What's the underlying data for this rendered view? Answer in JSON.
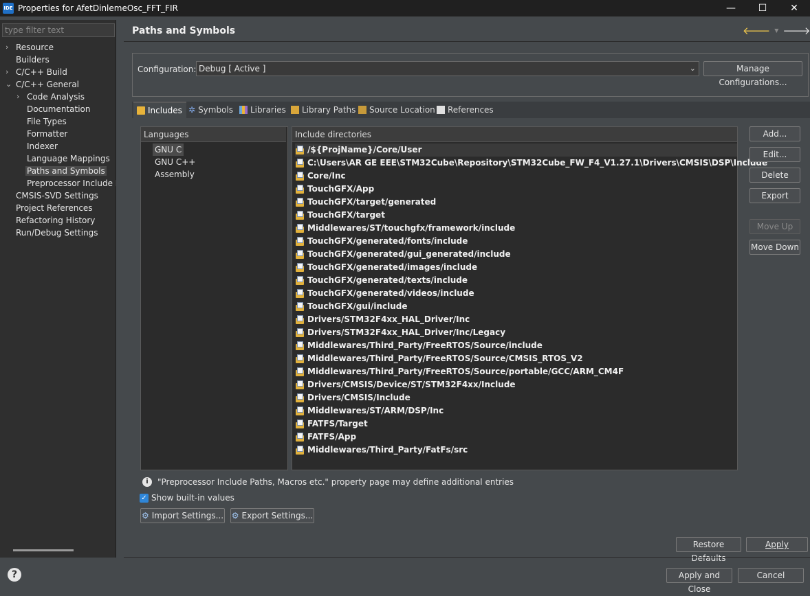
{
  "window": {
    "app_icon_text": "IDE",
    "title": "Properties for AfetDinlemeOsc_FFT_FIR",
    "controls": {
      "minimize": "—",
      "maximize": "☐",
      "close": "✕"
    }
  },
  "sidebar": {
    "filter_placeholder": "type filter text",
    "items": [
      {
        "label": "Resource",
        "arrow": "›"
      },
      {
        "label": "Builders",
        "arrow": ""
      },
      {
        "label": "C/C++ Build",
        "arrow": "›"
      },
      {
        "label": "C/C++ General",
        "arrow": "⌄"
      },
      {
        "label": "Code Analysis",
        "arrow": "›"
      },
      {
        "label": "Documentation",
        "arrow": ""
      },
      {
        "label": "File Types",
        "arrow": ""
      },
      {
        "label": "Formatter",
        "arrow": ""
      },
      {
        "label": "Indexer",
        "arrow": ""
      },
      {
        "label": "Language Mappings",
        "arrow": ""
      },
      {
        "label": "Paths and Symbols",
        "arrow": ""
      },
      {
        "label": "Preprocessor Include Pat",
        "arrow": ""
      },
      {
        "label": "CMSIS-SVD Settings",
        "arrow": ""
      },
      {
        "label": "Project References",
        "arrow": ""
      },
      {
        "label": "Refactoring History",
        "arrow": ""
      },
      {
        "label": "Run/Debug Settings",
        "arrow": ""
      }
    ]
  },
  "header": {
    "title": "Paths and Symbols",
    "back_icon": "arrow-left-icon",
    "forward_icon": "arrow-right-icon",
    "menu_glyph": "⋮"
  },
  "configuration": {
    "label": "Configuration:",
    "value": "Debug  [ Active ]",
    "manage_button": "Manage Configurations..."
  },
  "tabs": [
    {
      "label": "Includes",
      "icon": "includes-icon"
    },
    {
      "label": "Symbols",
      "icon": "symbols-icon"
    },
    {
      "label": "Libraries",
      "icon": "libraries-icon"
    },
    {
      "label": "Library Paths",
      "icon": "library-paths-icon"
    },
    {
      "label": "Source Location",
      "icon": "source-location-icon"
    },
    {
      "label": "References",
      "icon": "references-icon"
    }
  ],
  "languages": {
    "header": "Languages",
    "items": [
      "GNU C",
      "GNU C++",
      "Assembly"
    ]
  },
  "includes": {
    "header": "Include directories",
    "items": [
      "/${ProjName}/Core/User",
      "C:\\Users\\AR GE EEE\\STM32Cube\\Repository\\STM32Cube_FW_F4_V1.27.1\\Drivers\\CMSIS\\DSP\\Include",
      "Core/Inc",
      "TouchGFX/App",
      "TouchGFX/target/generated",
      "TouchGFX/target",
      "Middlewares/ST/touchgfx/framework/include",
      "TouchGFX/generated/fonts/include",
      "TouchGFX/generated/gui_generated/include",
      "TouchGFX/generated/images/include",
      "TouchGFX/generated/texts/include",
      "TouchGFX/generated/videos/include",
      "TouchGFX/gui/include",
      "Drivers/STM32F4xx_HAL_Driver/Inc",
      "Drivers/STM32F4xx_HAL_Driver/Inc/Legacy",
      "Middlewares/Third_Party/FreeRTOS/Source/include",
      "Middlewares/Third_Party/FreeRTOS/Source/CMSIS_RTOS_V2",
      "Middlewares/Third_Party/FreeRTOS/Source/portable/GCC/ARM_CM4F",
      "Drivers/CMSIS/Device/ST/STM32F4xx/Include",
      "Drivers/CMSIS/Include",
      "Middlewares/ST/ARM/DSP/Inc",
      "FATFS/Target",
      "FATFS/App",
      "Middlewares/Third_Party/FatFs/src"
    ]
  },
  "side_buttons": {
    "add": "Add...",
    "edit": "Edit...",
    "delete": "Delete",
    "export": "Export",
    "move_up": "Move Up",
    "move_down": "Move Down"
  },
  "info": {
    "glyph": "i",
    "text": "\"Preprocessor Include Paths, Macros etc.\" property page may define additional entries"
  },
  "show_builtin": {
    "label": "Show built-in values",
    "checked": true,
    "glyph": "✓"
  },
  "settings_buttons": {
    "import": "Import Settings...",
    "export": "Export Settings..."
  },
  "footer": {
    "restore_defaults": "Restore Defaults",
    "apply": "Apply",
    "apply_and_close": "Apply and Close",
    "cancel": "Cancel",
    "help_glyph": "?"
  }
}
